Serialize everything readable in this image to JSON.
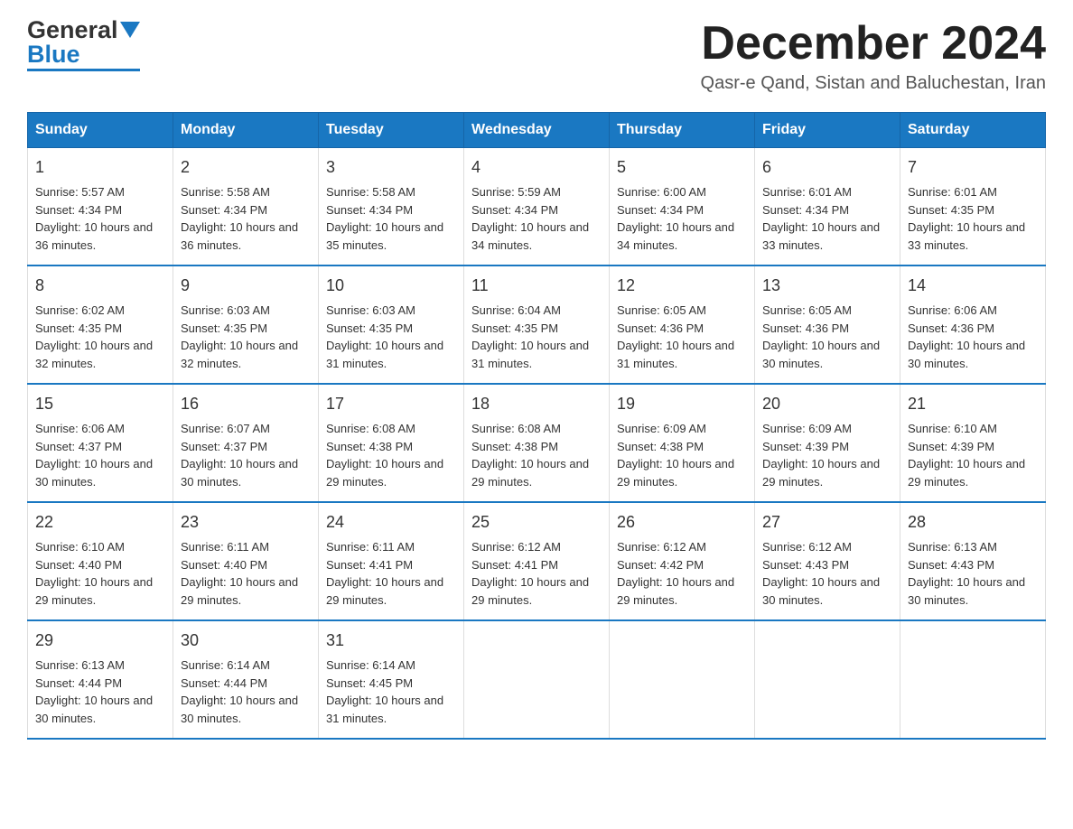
{
  "header": {
    "month_title": "December 2024",
    "location": "Qasr-e Qand, Sistan and Baluchestan, Iran",
    "logo_general": "General",
    "logo_blue": "Blue"
  },
  "days_of_week": [
    "Sunday",
    "Monday",
    "Tuesday",
    "Wednesday",
    "Thursday",
    "Friday",
    "Saturday"
  ],
  "weeks": [
    [
      {
        "day": "1",
        "sunrise": "Sunrise: 5:57 AM",
        "sunset": "Sunset: 4:34 PM",
        "daylight": "Daylight: 10 hours and 36 minutes."
      },
      {
        "day": "2",
        "sunrise": "Sunrise: 5:58 AM",
        "sunset": "Sunset: 4:34 PM",
        "daylight": "Daylight: 10 hours and 36 minutes."
      },
      {
        "day": "3",
        "sunrise": "Sunrise: 5:58 AM",
        "sunset": "Sunset: 4:34 PM",
        "daylight": "Daylight: 10 hours and 35 minutes."
      },
      {
        "day": "4",
        "sunrise": "Sunrise: 5:59 AM",
        "sunset": "Sunset: 4:34 PM",
        "daylight": "Daylight: 10 hours and 34 minutes."
      },
      {
        "day": "5",
        "sunrise": "Sunrise: 6:00 AM",
        "sunset": "Sunset: 4:34 PM",
        "daylight": "Daylight: 10 hours and 34 minutes."
      },
      {
        "day": "6",
        "sunrise": "Sunrise: 6:01 AM",
        "sunset": "Sunset: 4:34 PM",
        "daylight": "Daylight: 10 hours and 33 minutes."
      },
      {
        "day": "7",
        "sunrise": "Sunrise: 6:01 AM",
        "sunset": "Sunset: 4:35 PM",
        "daylight": "Daylight: 10 hours and 33 minutes."
      }
    ],
    [
      {
        "day": "8",
        "sunrise": "Sunrise: 6:02 AM",
        "sunset": "Sunset: 4:35 PM",
        "daylight": "Daylight: 10 hours and 32 minutes."
      },
      {
        "day": "9",
        "sunrise": "Sunrise: 6:03 AM",
        "sunset": "Sunset: 4:35 PM",
        "daylight": "Daylight: 10 hours and 32 minutes."
      },
      {
        "day": "10",
        "sunrise": "Sunrise: 6:03 AM",
        "sunset": "Sunset: 4:35 PM",
        "daylight": "Daylight: 10 hours and 31 minutes."
      },
      {
        "day": "11",
        "sunrise": "Sunrise: 6:04 AM",
        "sunset": "Sunset: 4:35 PM",
        "daylight": "Daylight: 10 hours and 31 minutes."
      },
      {
        "day": "12",
        "sunrise": "Sunrise: 6:05 AM",
        "sunset": "Sunset: 4:36 PM",
        "daylight": "Daylight: 10 hours and 31 minutes."
      },
      {
        "day": "13",
        "sunrise": "Sunrise: 6:05 AM",
        "sunset": "Sunset: 4:36 PM",
        "daylight": "Daylight: 10 hours and 30 minutes."
      },
      {
        "day": "14",
        "sunrise": "Sunrise: 6:06 AM",
        "sunset": "Sunset: 4:36 PM",
        "daylight": "Daylight: 10 hours and 30 minutes."
      }
    ],
    [
      {
        "day": "15",
        "sunrise": "Sunrise: 6:06 AM",
        "sunset": "Sunset: 4:37 PM",
        "daylight": "Daylight: 10 hours and 30 minutes."
      },
      {
        "day": "16",
        "sunrise": "Sunrise: 6:07 AM",
        "sunset": "Sunset: 4:37 PM",
        "daylight": "Daylight: 10 hours and 30 minutes."
      },
      {
        "day": "17",
        "sunrise": "Sunrise: 6:08 AM",
        "sunset": "Sunset: 4:38 PM",
        "daylight": "Daylight: 10 hours and 29 minutes."
      },
      {
        "day": "18",
        "sunrise": "Sunrise: 6:08 AM",
        "sunset": "Sunset: 4:38 PM",
        "daylight": "Daylight: 10 hours and 29 minutes."
      },
      {
        "day": "19",
        "sunrise": "Sunrise: 6:09 AM",
        "sunset": "Sunset: 4:38 PM",
        "daylight": "Daylight: 10 hours and 29 minutes."
      },
      {
        "day": "20",
        "sunrise": "Sunrise: 6:09 AM",
        "sunset": "Sunset: 4:39 PM",
        "daylight": "Daylight: 10 hours and 29 minutes."
      },
      {
        "day": "21",
        "sunrise": "Sunrise: 6:10 AM",
        "sunset": "Sunset: 4:39 PM",
        "daylight": "Daylight: 10 hours and 29 minutes."
      }
    ],
    [
      {
        "day": "22",
        "sunrise": "Sunrise: 6:10 AM",
        "sunset": "Sunset: 4:40 PM",
        "daylight": "Daylight: 10 hours and 29 minutes."
      },
      {
        "day": "23",
        "sunrise": "Sunrise: 6:11 AM",
        "sunset": "Sunset: 4:40 PM",
        "daylight": "Daylight: 10 hours and 29 minutes."
      },
      {
        "day": "24",
        "sunrise": "Sunrise: 6:11 AM",
        "sunset": "Sunset: 4:41 PM",
        "daylight": "Daylight: 10 hours and 29 minutes."
      },
      {
        "day": "25",
        "sunrise": "Sunrise: 6:12 AM",
        "sunset": "Sunset: 4:41 PM",
        "daylight": "Daylight: 10 hours and 29 minutes."
      },
      {
        "day": "26",
        "sunrise": "Sunrise: 6:12 AM",
        "sunset": "Sunset: 4:42 PM",
        "daylight": "Daylight: 10 hours and 29 minutes."
      },
      {
        "day": "27",
        "sunrise": "Sunrise: 6:12 AM",
        "sunset": "Sunset: 4:43 PM",
        "daylight": "Daylight: 10 hours and 30 minutes."
      },
      {
        "day": "28",
        "sunrise": "Sunrise: 6:13 AM",
        "sunset": "Sunset: 4:43 PM",
        "daylight": "Daylight: 10 hours and 30 minutes."
      }
    ],
    [
      {
        "day": "29",
        "sunrise": "Sunrise: 6:13 AM",
        "sunset": "Sunset: 4:44 PM",
        "daylight": "Daylight: 10 hours and 30 minutes."
      },
      {
        "day": "30",
        "sunrise": "Sunrise: 6:14 AM",
        "sunset": "Sunset: 4:44 PM",
        "daylight": "Daylight: 10 hours and 30 minutes."
      },
      {
        "day": "31",
        "sunrise": "Sunrise: 6:14 AM",
        "sunset": "Sunset: 4:45 PM",
        "daylight": "Daylight: 10 hours and 31 minutes."
      },
      {
        "day": "",
        "sunrise": "",
        "sunset": "",
        "daylight": ""
      },
      {
        "day": "",
        "sunrise": "",
        "sunset": "",
        "daylight": ""
      },
      {
        "day": "",
        "sunrise": "",
        "sunset": "",
        "daylight": ""
      },
      {
        "day": "",
        "sunrise": "",
        "sunset": "",
        "daylight": ""
      }
    ]
  ]
}
